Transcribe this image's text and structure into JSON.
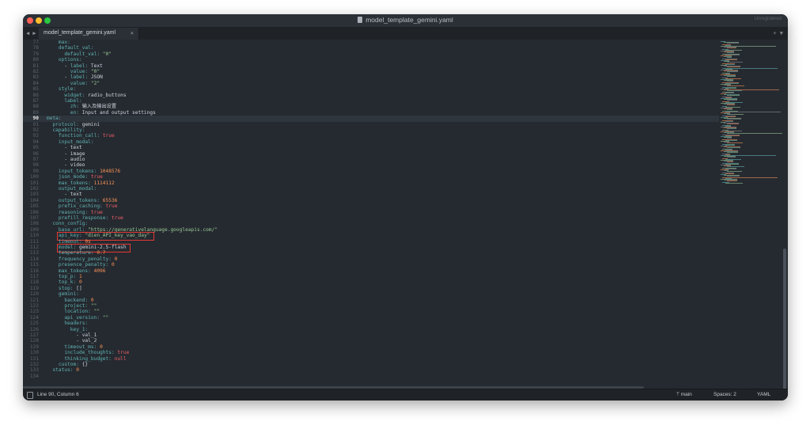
{
  "window": {
    "title": "model_template_gemini.yaml",
    "right_label": "Unregistered"
  },
  "tabbar": {
    "nav": "◀ ▶",
    "tab_label": "model_template_gemini.yaml",
    "tab_close": "×",
    "right_controls": "+ ▼"
  },
  "editor": {
    "current_line": 90,
    "lines": [
      {
        "n": "77",
        "t": [
          [
            "k",
            "    max:"
          ]
        ]
      },
      {
        "n": "78",
        "t": [
          [
            "k",
            "    default_val:"
          ]
        ]
      },
      {
        "n": "79",
        "t": [
          [
            "k",
            "      default_val: "
          ],
          [
            "s",
            "\"0\""
          ]
        ]
      },
      {
        "n": "80",
        "t": [
          [
            "k",
            "    options:"
          ]
        ]
      },
      {
        "n": "81",
        "t": [
          [
            "p",
            "      - "
          ],
          [
            "k",
            "label: "
          ],
          [
            "p",
            "Text"
          ]
        ]
      },
      {
        "n": "82",
        "t": [
          [
            "k",
            "        value: "
          ],
          [
            "s",
            "\"0\""
          ]
        ]
      },
      {
        "n": "83",
        "t": [
          [
            "p",
            "      - "
          ],
          [
            "k",
            "label: "
          ],
          [
            "p",
            "JSON"
          ]
        ]
      },
      {
        "n": "84",
        "t": [
          [
            "k",
            "        value: "
          ],
          [
            "s",
            "\"2\""
          ]
        ]
      },
      {
        "n": "85",
        "t": [
          [
            "k",
            "    style:"
          ]
        ]
      },
      {
        "n": "86",
        "t": [
          [
            "k",
            "      widget: "
          ],
          [
            "p",
            "radio_buttons"
          ]
        ]
      },
      {
        "n": "87",
        "t": [
          [
            "k",
            "      label:"
          ]
        ]
      },
      {
        "n": "88",
        "t": [
          [
            "k",
            "        zh: "
          ],
          [
            "p",
            "输入及输出设置"
          ]
        ]
      },
      {
        "n": "89",
        "t": [
          [
            "k",
            "        en: "
          ],
          [
            "p",
            "Input and output settings"
          ]
        ]
      },
      {
        "n": "90",
        "t": [
          [
            "k",
            "meta:"
          ]
        ]
      },
      {
        "n": "91",
        "t": [
          [
            "k",
            "  protocol: "
          ],
          [
            "p",
            "gemini"
          ]
        ]
      },
      {
        "n": "92",
        "t": [
          [
            "k",
            "  capability:"
          ]
        ]
      },
      {
        "n": "93",
        "t": [
          [
            "k",
            "    function_call: "
          ],
          [
            "b",
            "true"
          ]
        ]
      },
      {
        "n": "94",
        "t": [
          [
            "k",
            "    input_modal:"
          ]
        ]
      },
      {
        "n": "95",
        "t": [
          [
            "p",
            "      - text"
          ]
        ]
      },
      {
        "n": "96",
        "t": [
          [
            "p",
            "      - image"
          ]
        ]
      },
      {
        "n": "97",
        "t": [
          [
            "p",
            "      - audio"
          ]
        ]
      },
      {
        "n": "98",
        "t": [
          [
            "p",
            "      - video"
          ]
        ]
      },
      {
        "n": "99",
        "t": [
          [
            "k",
            "    input_tokens: "
          ],
          [
            "n",
            "1048576"
          ]
        ]
      },
      {
        "n": "100",
        "t": [
          [
            "k",
            "    json_mode: "
          ],
          [
            "b",
            "true"
          ]
        ]
      },
      {
        "n": "101",
        "t": [
          [
            "k",
            "    max_tokens: "
          ],
          [
            "n",
            "1114112"
          ]
        ]
      },
      {
        "n": "102",
        "t": [
          [
            "k",
            "    output_modal:"
          ]
        ]
      },
      {
        "n": "103",
        "t": [
          [
            "p",
            "      - text"
          ]
        ]
      },
      {
        "n": "104",
        "t": [
          [
            "k",
            "    output_tokens: "
          ],
          [
            "n",
            "65536"
          ]
        ]
      },
      {
        "n": "105",
        "t": [
          [
            "k",
            "    prefix_caching: "
          ],
          [
            "b",
            "true"
          ]
        ]
      },
      {
        "n": "106",
        "t": [
          [
            "k",
            "    reasoning: "
          ],
          [
            "b",
            "true"
          ]
        ]
      },
      {
        "n": "107",
        "t": [
          [
            "k",
            "    prefill_response: "
          ],
          [
            "b",
            "true"
          ]
        ]
      },
      {
        "n": "108",
        "t": [
          [
            "k",
            "  conn_config:"
          ]
        ]
      },
      {
        "n": "109",
        "t": [
          [
            "k",
            "    base_url: "
          ],
          [
            "s",
            "\"https://generativelanguage.googleapis.com/\""
          ]
        ]
      },
      {
        "n": "110",
        "t": [
          [
            "k",
            "    api_key: "
          ],
          [
            "s",
            "\"dien_API_key_vao_day\""
          ]
        ]
      },
      {
        "n": "111",
        "t": [
          [
            "k",
            "    timeout: "
          ],
          [
            "n",
            "0s"
          ]
        ]
      },
      {
        "n": "112",
        "t": [
          [
            "k",
            "    model: "
          ],
          [
            "p",
            "gemini-2.5-flash"
          ]
        ]
      },
      {
        "n": "113",
        "t": [
          [
            "k",
            "    temperature: "
          ],
          [
            "n",
            "0.7"
          ]
        ]
      },
      {
        "n": "114",
        "t": [
          [
            "k",
            "    frequency_penalty: "
          ],
          [
            "n",
            "0"
          ]
        ]
      },
      {
        "n": "115",
        "t": [
          [
            "k",
            "    presence_penalty: "
          ],
          [
            "n",
            "0"
          ]
        ]
      },
      {
        "n": "116",
        "t": [
          [
            "k",
            "    max_tokens: "
          ],
          [
            "n",
            "4096"
          ]
        ]
      },
      {
        "n": "117",
        "t": [
          [
            "k",
            "    top_p: "
          ],
          [
            "n",
            "1"
          ]
        ]
      },
      {
        "n": "118",
        "t": [
          [
            "k",
            "    top_k: "
          ],
          [
            "n",
            "0"
          ]
        ]
      },
      {
        "n": "119",
        "t": [
          [
            "k",
            "    stop: "
          ],
          [
            "p",
            "[]"
          ]
        ]
      },
      {
        "n": "120",
        "t": [
          [
            "k",
            "    gemini:"
          ]
        ]
      },
      {
        "n": "121",
        "t": [
          [
            "k",
            "      backend: "
          ],
          [
            "n",
            "0"
          ]
        ]
      },
      {
        "n": "122",
        "t": [
          [
            "k",
            "      project: "
          ],
          [
            "s",
            "\"\""
          ]
        ]
      },
      {
        "n": "123",
        "t": [
          [
            "k",
            "      location: "
          ],
          [
            "s",
            "\"\""
          ]
        ]
      },
      {
        "n": "124",
        "t": [
          [
            "k",
            "      api_version: "
          ],
          [
            "s",
            "\"\""
          ]
        ]
      },
      {
        "n": "125",
        "t": [
          [
            "k",
            "      headers:"
          ]
        ]
      },
      {
        "n": "126",
        "t": [
          [
            "k",
            "        key_1:"
          ]
        ]
      },
      {
        "n": "127",
        "t": [
          [
            "p",
            "          - val_1"
          ]
        ]
      },
      {
        "n": "128",
        "t": [
          [
            "p",
            "          - val_2"
          ]
        ]
      },
      {
        "n": "129",
        "t": [
          [
            "k",
            "      timeout_ms: "
          ],
          [
            "n",
            "0"
          ]
        ]
      },
      {
        "n": "130",
        "t": [
          [
            "k",
            "      include_thoughts: "
          ],
          [
            "b",
            "true"
          ]
        ]
      },
      {
        "n": "131",
        "t": [
          [
            "k",
            "      thinking_budget: "
          ],
          [
            "b",
            "null"
          ]
        ]
      },
      {
        "n": "132",
        "t": [
          [
            "k",
            "    custom: "
          ],
          [
            "p",
            "{}"
          ]
        ]
      },
      {
        "n": "133",
        "t": [
          [
            "k",
            "  status: "
          ],
          [
            "n",
            "0"
          ]
        ]
      },
      {
        "n": "134",
        "t": []
      }
    ]
  },
  "statusbar": {
    "position": "Line 90, Column 6",
    "branch": "ᛘ main",
    "spaces": "Spaces: 2",
    "syntax": "YAML"
  },
  "colors": {
    "key": "#5fb3b3",
    "string": "#99c794",
    "number": "#f99157",
    "boolean": "#ec5f67",
    "highlight_box": "#e53935",
    "background": "#252a30"
  }
}
